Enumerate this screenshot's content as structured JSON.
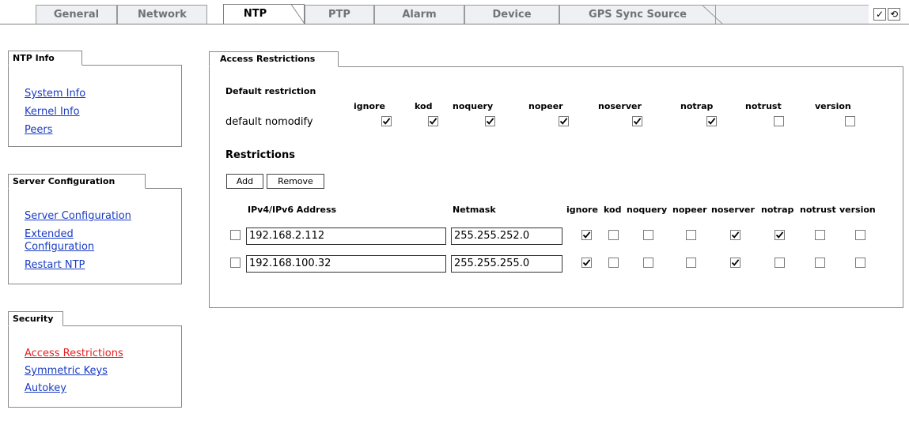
{
  "tabs": [
    "General",
    "Network",
    "NTP",
    "PTP",
    "Alarm",
    "Device",
    "GPS Sync Source"
  ],
  "toolbar": {
    "apply_icon": "✓",
    "reload_icon": "⟲"
  },
  "ntp_info": {
    "title": "NTP Info",
    "links": [
      "System Info",
      "Kernel Info",
      "Peers"
    ]
  },
  "server_config": {
    "title": "Server Configuration",
    "links": [
      "Server Configuration",
      "Extended",
      "Configuration",
      "Restart NTP"
    ]
  },
  "security": {
    "title": "Security",
    "links": [
      "Access Restrictions",
      "Symmetric Keys",
      "Autokey"
    ]
  },
  "access": {
    "title": "Access Restrictions",
    "default_heading": "Default restriction",
    "default_label": "default nomodify",
    "columns": [
      "ignore",
      "kod",
      "noquery",
      "nopeer",
      "noserver",
      "notrap",
      "notrust",
      "version"
    ],
    "default_values": [
      true,
      true,
      true,
      true,
      true,
      true,
      false,
      false
    ],
    "restrictions_heading": "Restrictions",
    "add_label": "Add",
    "remove_label": "Remove",
    "address_header": "IPv4/IPv6 Address",
    "netmask_header": "Netmask",
    "rows": [
      {
        "selected": false,
        "address": "192.168.2.112",
        "netmask": "255.255.252.0",
        "flags": [
          true,
          false,
          false,
          false,
          true,
          true,
          false,
          false
        ]
      },
      {
        "selected": false,
        "address": "192.168.100.32",
        "netmask": "255.255.255.0",
        "flags": [
          true,
          false,
          false,
          false,
          true,
          false,
          false,
          false
        ]
      }
    ]
  }
}
